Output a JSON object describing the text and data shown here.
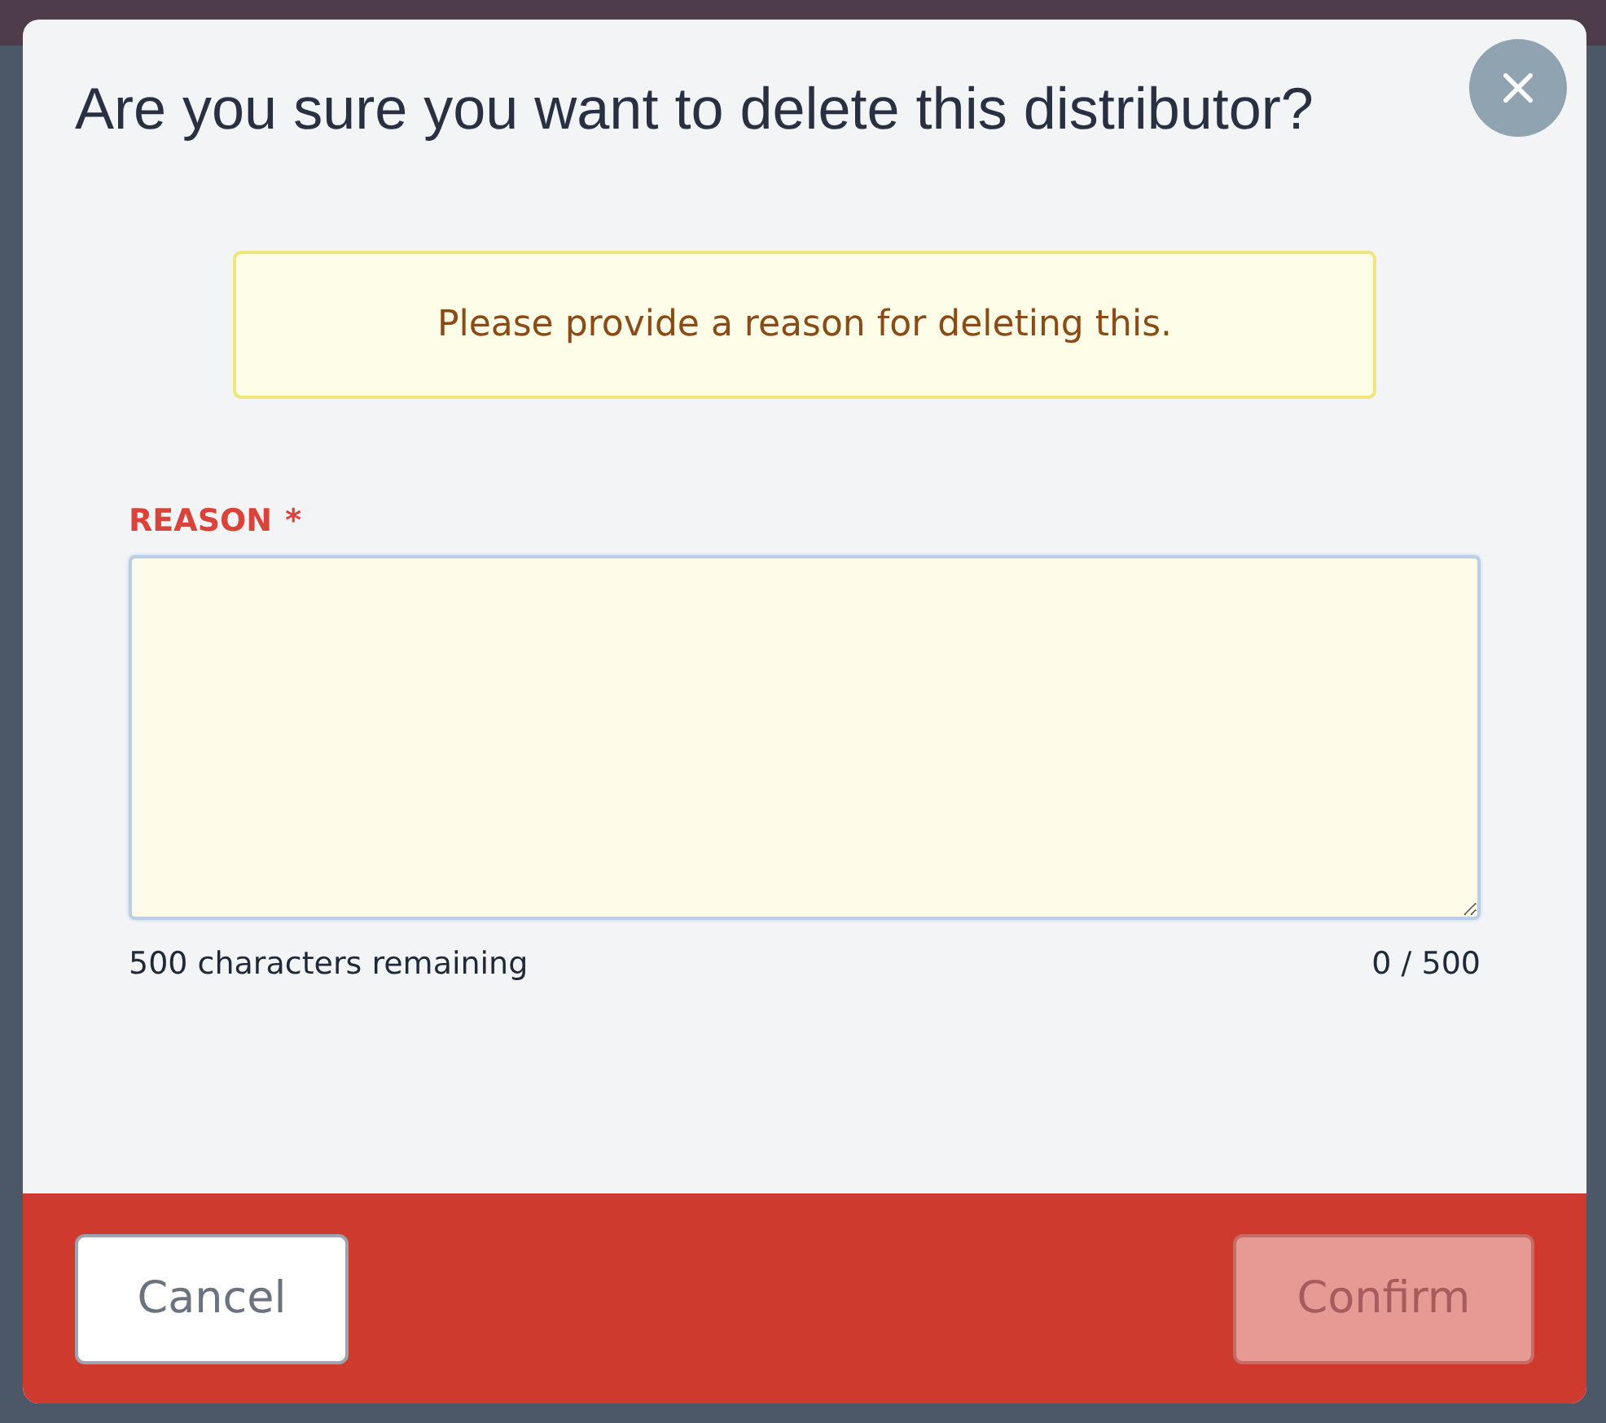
{
  "dialog": {
    "title": "Are you sure you want to delete this distributor?",
    "notice": "Please provide a reason for deleting this.",
    "field": {
      "label": "REASON",
      "required_mark": "*",
      "remaining": "500 characters remaining",
      "count": "0 / 500"
    },
    "buttons": [
      {
        "label": "Cancel",
        "kind": "secondary",
        "disabled": false
      },
      {
        "label": "Confirm",
        "kind": "primary",
        "disabled": true
      }
    ]
  }
}
